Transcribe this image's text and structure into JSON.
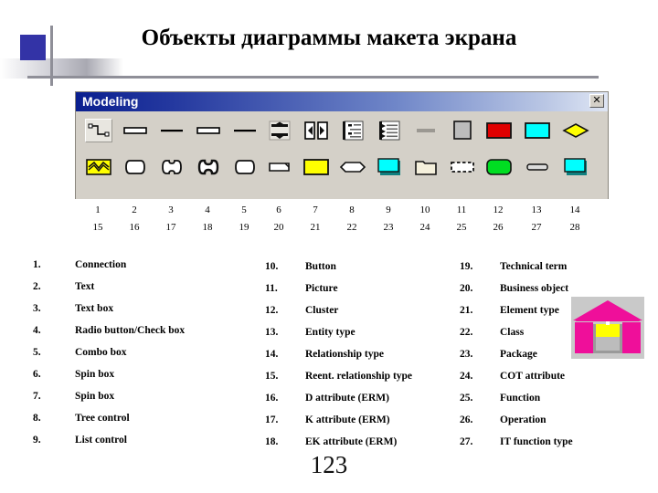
{
  "slide": {
    "title": "Объекты диаграммы макета экрана",
    "page_number": "123"
  },
  "toolbar": {
    "title": "Modeling",
    "close_label": "✕",
    "row1_icons": [
      "connection-icon",
      "text-box-icon",
      "text-line-icon",
      "text-box2-icon",
      "text-line2-icon",
      "spin-box-vertical-icon",
      "spin-box-horizontal-icon",
      "tree-control-icon",
      "list-control-icon",
      "button-bar-icon",
      "picture-box-icon",
      "cluster-red-icon",
      "entity-type-cyan-icon",
      "relationship-diamond-icon"
    ],
    "row2_icons": [
      "reent-relationship-icon",
      "d-attribute-icon",
      "k-attribute-icon",
      "ek-attribute-icon",
      "technical-term-icon",
      "business-object-icon",
      "element-type-yellow-icon",
      "class-hexagon-icon",
      "package-cyan-icon",
      "folder-icon",
      "cot-attribute-dashed-icon",
      "function-green-icon",
      "operation-small-icon",
      "it-function-type-icon"
    ]
  },
  "numbers": {
    "row1": [
      "1",
      "2",
      "3",
      "4",
      "5",
      "6",
      "7",
      "8",
      "9",
      "10",
      "11",
      "12",
      "13",
      "14"
    ],
    "row2": [
      "15",
      "16",
      "17",
      "18",
      "19",
      "20",
      "21",
      "22",
      "23",
      "24",
      "25",
      "26",
      "27",
      "28"
    ]
  },
  "legend": {
    "column1": [
      {
        "num": "1.",
        "label": "Connection"
      },
      {
        "num": "2.",
        "label": "Text"
      },
      {
        "num": "3.",
        "label": "Text box"
      },
      {
        "num": "4.",
        "label": "Radio button/Check box"
      },
      {
        "num": "5.",
        "label": "Combo box"
      },
      {
        "num": "6.",
        "label": "Spin box"
      },
      {
        "num": "7.",
        "label": "Spin box"
      },
      {
        "num": "8.",
        "label": "Tree control"
      },
      {
        "num": "9.",
        "label": "List control"
      }
    ],
    "column2": [
      {
        "num": "10.",
        "label": "Button"
      },
      {
        "num": "11.",
        "label": "Picture"
      },
      {
        "num": "12.",
        "label": "Cluster"
      },
      {
        "num": "13.",
        "label": "Entity type"
      },
      {
        "num": "14.",
        "label": "Relationship type"
      },
      {
        "num": "15.",
        "label": "Reent. relationship type"
      },
      {
        "num": "16.",
        "label": "D attribute (ERM)"
      },
      {
        "num": "17.",
        "label": "K attribute (ERM)"
      },
      {
        "num": "18.",
        "label": "EK attribute (ERM)"
      }
    ],
    "column3": [
      {
        "num": "19.",
        "label": "Technical term"
      },
      {
        "num": "20.",
        "label": "Business object"
      },
      {
        "num": "21.",
        "label": "Element type"
      },
      {
        "num": "22.",
        "label": "Class"
      },
      {
        "num": "23.",
        "label": "Package"
      },
      {
        "num": "24.",
        "label": "COT attribute"
      },
      {
        "num": "25.",
        "label": "Function"
      },
      {
        "num": "26.",
        "label": "Operation"
      },
      {
        "num": "27.",
        "label": "IT function type"
      }
    ]
  },
  "logo": {
    "name": "house-logo",
    "roof_color": "#ef0f9a",
    "wall_color": "#ef0f9a",
    "top_color": "#ffff00",
    "center_color": "#bcbcbc",
    "background_color": "#c9c9c9"
  },
  "colors": {
    "accent_blue": "#3333a6",
    "titlebar_dark": "#0a1f8f",
    "toolbar_face": "#d4d0c8",
    "red": "#e00000",
    "cyan": "#00ffff",
    "yellow": "#ffff00",
    "green": "#00dd22"
  }
}
